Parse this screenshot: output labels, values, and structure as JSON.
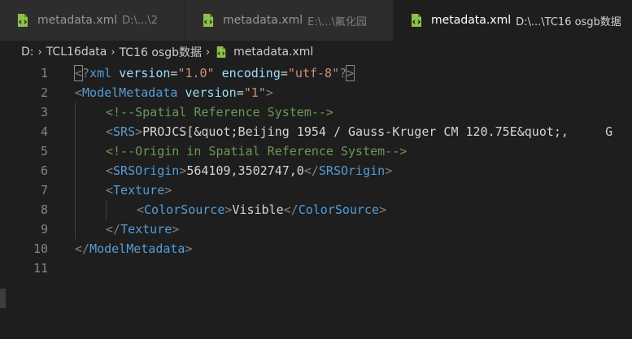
{
  "tabs": [
    {
      "name": "metadata.xml",
      "path": "D:\\...\\2",
      "active": false
    },
    {
      "name": "metadata.xml",
      "path": "E:\\...\\氟化园",
      "active": false
    },
    {
      "name": "metadata.xml",
      "path": "D:\\...\\TC16 osgb数据",
      "active": true
    }
  ],
  "breadcrumb": {
    "segments": [
      "D:",
      "TCL16data",
      "TC16 osgb数据"
    ],
    "file": "metadata.xml"
  },
  "colors": {
    "background": "#1e1e1e",
    "file_icon": "#8dc149",
    "tag": "#569cd6",
    "attribute": "#9cdcfe",
    "string": "#ce9178",
    "comment": "#6a9955"
  },
  "editor": {
    "lines": [
      {
        "num": "1",
        "indent": 0,
        "tokens": [
          {
            "t": "<",
            "c": "tag-p brk"
          },
          {
            "t": "?",
            "c": "tag-p"
          },
          {
            "t": "xml",
            "c": "tag-n"
          },
          {
            "t": " ",
            "c": "txt"
          },
          {
            "t": "version",
            "c": "attr"
          },
          {
            "t": "=",
            "c": "txt"
          },
          {
            "t": "\"1.0\"",
            "c": "str"
          },
          {
            "t": " ",
            "c": "txt"
          },
          {
            "t": "encoding",
            "c": "attr"
          },
          {
            "t": "=",
            "c": "txt"
          },
          {
            "t": "\"utf-8\"",
            "c": "str"
          },
          {
            "t": "?",
            "c": "tag-p"
          },
          {
            "t": ">",
            "c": "tag-p brk"
          }
        ]
      },
      {
        "num": "2",
        "indent": 0,
        "tokens": [
          {
            "t": "<",
            "c": "tag-p"
          },
          {
            "t": "ModelMetadata",
            "c": "tag-n"
          },
          {
            "t": " ",
            "c": "txt"
          },
          {
            "t": "version",
            "c": "attr"
          },
          {
            "t": "=",
            "c": "txt"
          },
          {
            "t": "\"1\"",
            "c": "str"
          },
          {
            "t": ">",
            "c": "tag-p"
          }
        ]
      },
      {
        "num": "3",
        "indent": 1,
        "tokens": [
          {
            "t": "<!--Spatial Reference System-->",
            "c": "cmt"
          }
        ]
      },
      {
        "num": "4",
        "indent": 1,
        "tokens": [
          {
            "t": "<",
            "c": "tag-p"
          },
          {
            "t": "SRS",
            "c": "tag-n"
          },
          {
            "t": ">",
            "c": "tag-p"
          },
          {
            "t": "PROJCS[&quot;Beijing 1954 / Gauss-Kruger CM 120.75E&quot;,     G",
            "c": "txt"
          }
        ]
      },
      {
        "num": "5",
        "indent": 1,
        "tokens": [
          {
            "t": "<!--Origin in Spatial Reference System-->",
            "c": "cmt"
          }
        ]
      },
      {
        "num": "6",
        "indent": 1,
        "tokens": [
          {
            "t": "<",
            "c": "tag-p"
          },
          {
            "t": "SRSOrigin",
            "c": "tag-n"
          },
          {
            "t": ">",
            "c": "tag-p"
          },
          {
            "t": "564109,3502747,0",
            "c": "txt"
          },
          {
            "t": "</",
            "c": "tag-p"
          },
          {
            "t": "SRSOrigin",
            "c": "tag-n"
          },
          {
            "t": ">",
            "c": "tag-p"
          }
        ]
      },
      {
        "num": "7",
        "indent": 1,
        "tokens": [
          {
            "t": "<",
            "c": "tag-p"
          },
          {
            "t": "Texture",
            "c": "tag-n"
          },
          {
            "t": ">",
            "c": "tag-p"
          }
        ]
      },
      {
        "num": "8",
        "indent": 2,
        "tokens": [
          {
            "t": "<",
            "c": "tag-p"
          },
          {
            "t": "ColorSource",
            "c": "tag-n"
          },
          {
            "t": ">",
            "c": "tag-p"
          },
          {
            "t": "Visible",
            "c": "txt"
          },
          {
            "t": "</",
            "c": "tag-p"
          },
          {
            "t": "ColorSource",
            "c": "tag-n"
          },
          {
            "t": ">",
            "c": "tag-p"
          }
        ]
      },
      {
        "num": "9",
        "indent": 1,
        "tokens": [
          {
            "t": "</",
            "c": "tag-p"
          },
          {
            "t": "Texture",
            "c": "tag-n"
          },
          {
            "t": ">",
            "c": "tag-p"
          }
        ]
      },
      {
        "num": "10",
        "indent": 0,
        "tokens": [
          {
            "t": "</",
            "c": "tag-p"
          },
          {
            "t": "ModelMetadata",
            "c": "tag-n"
          },
          {
            "t": ">",
            "c": "tag-p"
          }
        ]
      },
      {
        "num": "11",
        "indent": 0,
        "tokens": []
      }
    ]
  }
}
